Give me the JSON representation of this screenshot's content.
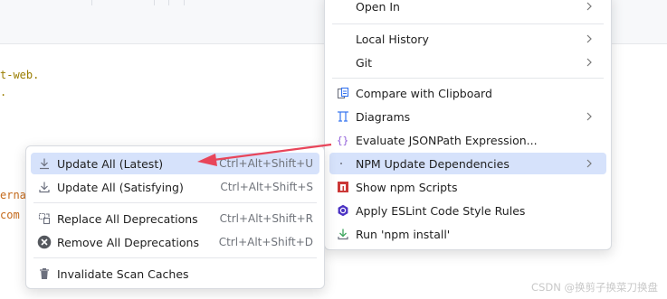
{
  "watermark": "CSDN @换剪子换菜刀换盘",
  "editor": {
    "fragments": [
      "t-web.",
      ".",
      "erna",
      "com"
    ]
  },
  "right_menu": {
    "items": [
      {
        "label": "Open In",
        "submenu": true
      },
      {
        "label": "Local History",
        "submenu": true
      },
      {
        "label": "Git",
        "submenu": true
      },
      {
        "label": "Compare with Clipboard"
      },
      {
        "label": "Diagrams",
        "submenu": true
      },
      {
        "label": "Evaluate JSONPath Expression..."
      },
      {
        "label": "NPM Update Dependencies",
        "submenu": true,
        "highlighted": true
      },
      {
        "label": "Show npm Scripts"
      },
      {
        "label": "Apply ESLint Code Style Rules"
      },
      {
        "label": "Run 'npm install'"
      }
    ]
  },
  "left_menu": {
    "items": [
      {
        "label": "Update All (Latest)",
        "shortcut": "Ctrl+Alt+Shift+U",
        "highlighted": true
      },
      {
        "label": "Update All (Satisfying)",
        "shortcut": "Ctrl+Alt+Shift+S"
      },
      {
        "label": "Replace All Deprecations",
        "shortcut": "Ctrl+Alt+Shift+R"
      },
      {
        "label": "Remove All Deprecations",
        "shortcut": "Ctrl+Alt+Shift+D"
      },
      {
        "label": "Invalidate Scan Caches"
      }
    ]
  },
  "colors": {
    "highlight": "#d6e2fb",
    "annotation_arrow": "#e8455a",
    "npm_red": "#cb3837",
    "eslint_purple": "#4b32c3"
  }
}
